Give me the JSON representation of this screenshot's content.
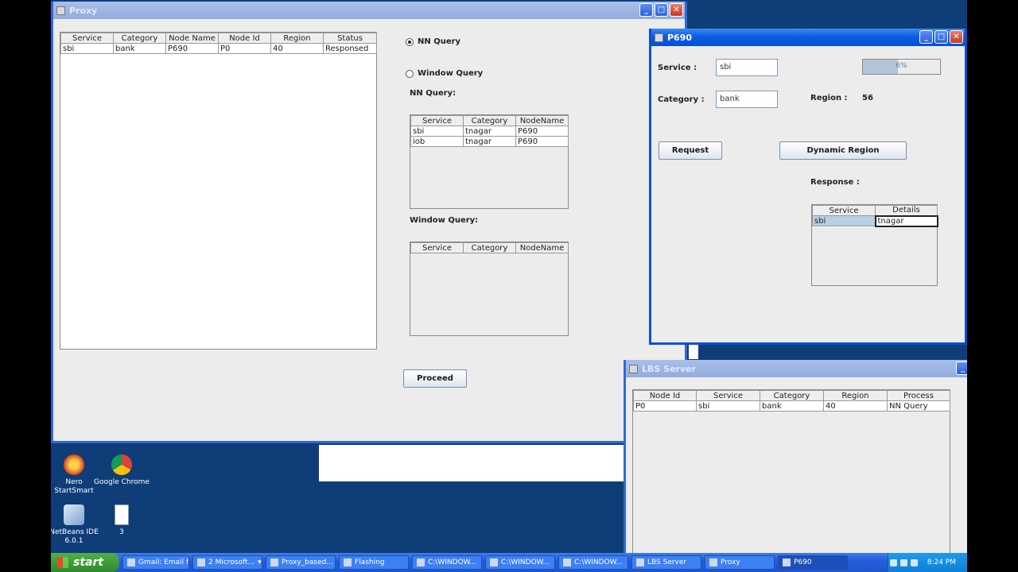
{
  "proxy": {
    "title": "Proxy",
    "main_table": {
      "columns": [
        "Service",
        "Category",
        "Node Name",
        "Node Id",
        "Region",
        "Status"
      ],
      "rows": [
        [
          "sbi",
          "bank",
          "P690",
          "P0",
          "40",
          "Responsed"
        ]
      ]
    },
    "radio_nn": "NN Query",
    "radio_window": "Window Query",
    "nn_label": "NN Query:",
    "nn_table": {
      "columns": [
        "Service",
        "Category",
        "NodeName"
      ],
      "rows": [
        [
          "sbi",
          "tnagar",
          "P690"
        ],
        [
          "iob",
          "tnagar",
          "P690"
        ]
      ]
    },
    "window_label": "Window Query:",
    "window_table": {
      "columns": [
        "Service",
        "Category",
        "NodeName"
      ],
      "rows": []
    },
    "proceed_label": "Proceed"
  },
  "p690": {
    "title": "P690",
    "service_label": "Service :",
    "service_value": "sbi",
    "category_label": "Category :",
    "category_value": "bank",
    "progress_text": "6%",
    "progress_fraction": 0.45,
    "region_label": "Region :",
    "region_value": "56",
    "request_label": "Request",
    "dynamic_region_label": "Dynamic Region",
    "response_label": "Response :",
    "response_table": {
      "columns": [
        "Service",
        "Details"
      ],
      "rows": [
        [
          "sbi",
          "tnagar"
        ]
      ]
    }
  },
  "lbs": {
    "title": "LBS Server",
    "table": {
      "columns": [
        "Node Id",
        "Service",
        "Category",
        "Region",
        "Process"
      ],
      "rows": [
        [
          "P0",
          "sbi",
          "bank",
          "40",
          "NN Query"
        ]
      ]
    }
  },
  "desktop_icons": [
    {
      "label": "Nero StartSmart",
      "icon": "nero-icon"
    },
    {
      "label": "Google Chrome",
      "icon": "chrome-icon"
    },
    {
      "label": "NetBeans IDE 6.0.1",
      "icon": "netbeans-icon"
    },
    {
      "label": "3",
      "icon": "document-icon"
    }
  ],
  "taskbar": {
    "start_label": "start",
    "tasks": [
      "Gmail: Email f...",
      "2 Microsoft...",
      "Proxy_based...",
      "Flashing",
      "C:\\WINDOW...",
      "C:\\WINDOW...",
      "C:\\WINDOW...",
      "LBS Server",
      "Proxy",
      "P690"
    ],
    "clock": "8:24 PM"
  }
}
